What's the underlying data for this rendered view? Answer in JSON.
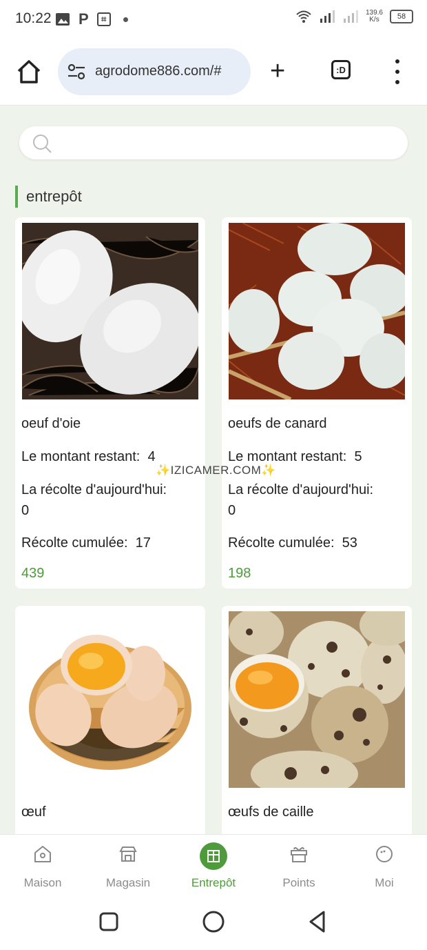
{
  "status_bar": {
    "time": "10:22",
    "net_speed": "139.6",
    "net_unit": "K/s",
    "battery": "58"
  },
  "browser": {
    "url": "agrodome886.com/#",
    "tabs_label": ":D"
  },
  "search": {
    "placeholder": ""
  },
  "section": {
    "title": "entrepôt"
  },
  "products": [
    {
      "name": "oeuf d'oie",
      "remaining_label": "Le montant restant:",
      "remaining": "4",
      "today_label": "La récolte d'aujourd'hui:",
      "today": "0",
      "cumulative_label": "Récolte cumulée:",
      "cumulative": "17",
      "price": "439"
    },
    {
      "name": "oeufs de canard",
      "remaining_label": "Le montant restant:",
      "remaining": "5",
      "today_label": "La récolte d'aujourd'hui:",
      "today": "0",
      "cumulative_label": "Récolte cumulée:",
      "cumulative": "53",
      "price": "198"
    },
    {
      "name": "œuf"
    },
    {
      "name": "œufs de caille"
    }
  ],
  "watermark": "✨IZICAMER.COM✨",
  "nav": [
    {
      "label": "Maison",
      "icon": "house-icon"
    },
    {
      "label": "Magasin",
      "icon": "shop-icon"
    },
    {
      "label": "Entrepôt",
      "icon": "warehouse-icon",
      "active": true
    },
    {
      "label": "Points",
      "icon": "gift-icon"
    },
    {
      "label": "Moi",
      "icon": "profile-icon"
    }
  ],
  "colors": {
    "accent": "#4d9b3b",
    "background": "#eef4ec"
  }
}
